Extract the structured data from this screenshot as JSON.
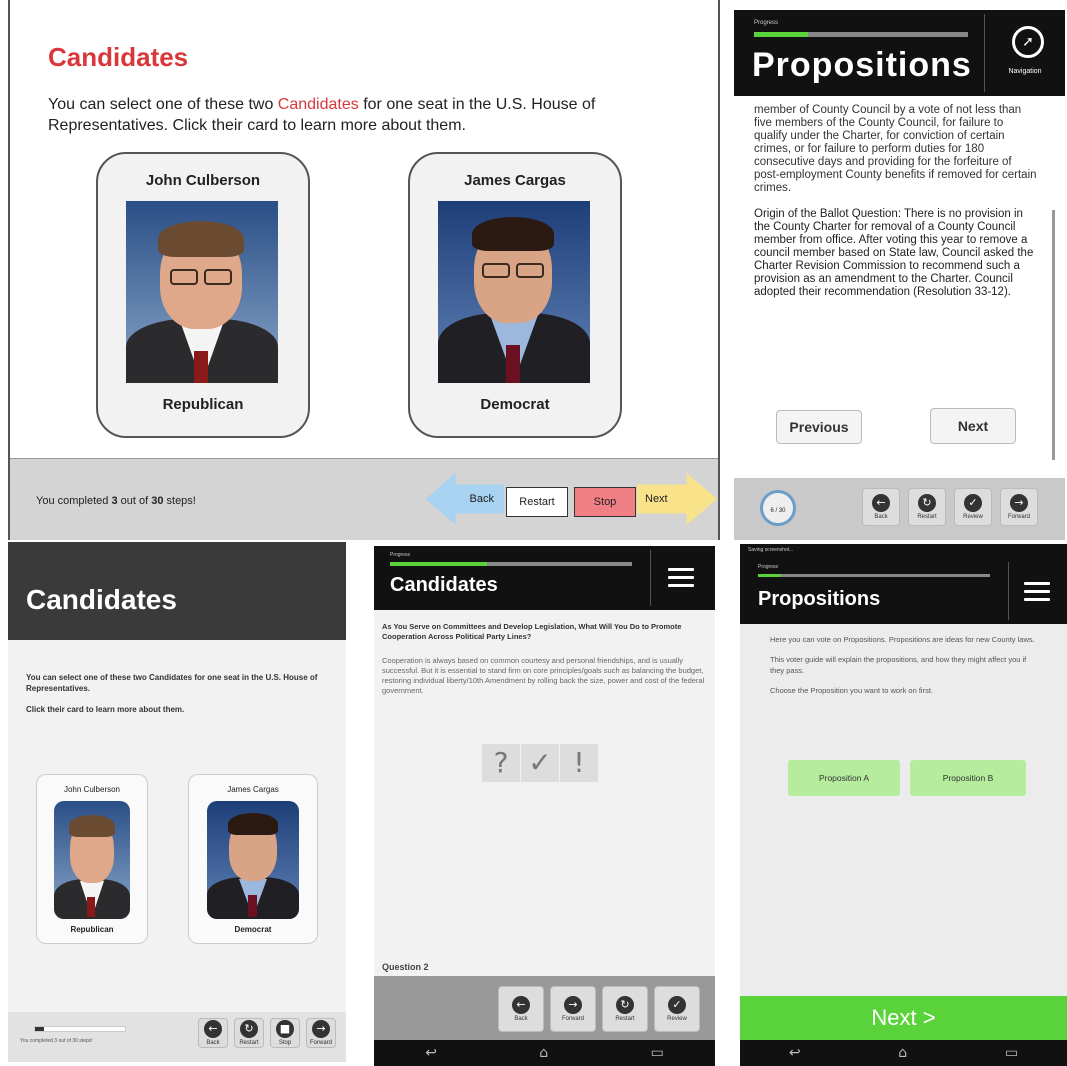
{
  "p1": {
    "title": "Candidates",
    "intro_before": "You can select one of these two ",
    "intro_highlight": "Candidates",
    "intro_after": " for one seat in the U.S. House of Representatives. Click their card to learn more about them.",
    "candidates": [
      {
        "name": "John Culberson",
        "party": "Republican"
      },
      {
        "name": "James Cargas",
        "party": "Democrat"
      }
    ],
    "progress_pre": "You completed ",
    "progress_done": "3",
    "progress_mid": " out of ",
    "progress_total": "30",
    "progress_post": " steps!",
    "buttons": {
      "back": "Back",
      "restart": "Restart",
      "stop": "Stop",
      "next": "Next"
    },
    "colors": {
      "title": "#d9383a",
      "back": "#a7d3f0",
      "stop": "#f07f86",
      "next": "#f8e28a"
    }
  },
  "p2": {
    "progress_label": "Progress",
    "title": "Propositions",
    "nav_label": "Navigation",
    "para1": "member of County Council by a vote of not less than five members of the County Council, for failure to qualify under the Charter, for conviction of certain crimes, or for failure to perform duties for 180 consecutive days and providing for the forfeiture of post-employment County benefits if removed for certain crimes.",
    "para2": "Origin of the Ballot Question: There is no provision in the County Charter for removal of a County Council member from office. After voting this year to remove a council member based on State law, Council asked the Charter Revision Commission to recommend such a provision as an amendment to the Charter. Council adopted their recommendation (Resolution 33-12).",
    "previous": "Previous",
    "next": "Next",
    "timer": "6 / 30",
    "toolbar": [
      {
        "label": "Back",
        "icon": "back-icon",
        "glyph": "←"
      },
      {
        "label": "Restart",
        "icon": "restart-icon",
        "glyph": "↻"
      },
      {
        "label": "Review",
        "icon": "review-icon",
        "glyph": "✓"
      },
      {
        "label": "Forward",
        "icon": "forward-icon",
        "glyph": "→"
      }
    ]
  },
  "p3": {
    "title": "Candidates",
    "intro1": "You can select one of these two Candidates for one seat in the U.S. House of Representatives.",
    "intro2": "Click their card to learn more about them.",
    "candidates": [
      {
        "name": "John Culberson",
        "party": "Republican"
      },
      {
        "name": "James Cargas",
        "party": "Democrat"
      }
    ],
    "progress_text": "You completed 3 out of 30 steps!",
    "toolbar": [
      {
        "label": "Back",
        "icon": "back-icon",
        "glyph": "←"
      },
      {
        "label": "Restart",
        "icon": "restart-icon",
        "glyph": "↻"
      },
      {
        "label": "Stop",
        "icon": "stop-icon",
        "glyph": "■"
      },
      {
        "label": "Forward",
        "icon": "forward-icon",
        "glyph": "→"
      }
    ]
  },
  "p4": {
    "progress_label": "Progress",
    "title": "Candidates",
    "question": "As You Serve on Committees and Develop Legislation, What Will You Do to Promote Cooperation Across Political Party Lines?",
    "answer": "Cooperation is always based on common courtesy and personal friendships, and is usually successful. But it is essential to stand firm on core principles/goals such as balancing the budget, restoring individual liberty/10th Amendment by rolling back the size, power and cost of the federal government.",
    "reactions": [
      "?",
      "✓",
      "!"
    ],
    "question_num": "Question 2",
    "toolbar": [
      {
        "label": "Back",
        "icon": "back-icon",
        "glyph": "←"
      },
      {
        "label": "Forward",
        "icon": "forward-icon",
        "glyph": "→"
      },
      {
        "label": "Restart",
        "icon": "restart-icon",
        "glyph": "↻"
      },
      {
        "label": "Review",
        "icon": "review-icon",
        "glyph": "✓"
      }
    ]
  },
  "p5": {
    "status": "Saving screenshot...",
    "progress_label": "Progress",
    "title": "Propositions",
    "para1": "Here you can vote on Propositions. Propositions are ideas for new County laws.",
    "para2": "This voter guide will explain the propositions, and how they might affect you if they pass.",
    "para3": "Choose the Proposition you want to work on first.",
    "prop_a": "Proposition A",
    "prop_b": "Proposition B",
    "next": "Next >",
    "colors": {
      "next_bar": "#5ad33a",
      "prop_button": "#b6ec9e"
    }
  }
}
